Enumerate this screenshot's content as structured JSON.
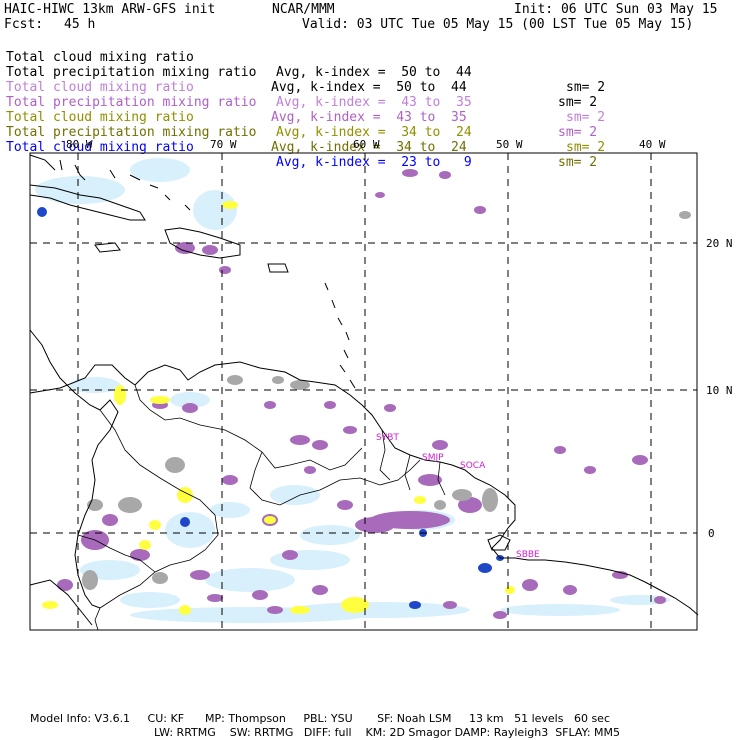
{
  "header": {
    "model_title": "HAIC-HIWC 13km ARW-GFS init",
    "org": "NCAR/MMM",
    "init": "Init: 06 UTC Sun 03 May 15",
    "fcst_label": "Fcst:",
    "fcst_value": "45 h",
    "valid": "Valid: 03 UTC Tue 05 May 15 (00 LST Tue 05 May 15)"
  },
  "legend": [
    {
      "name": "Total cloud mixing ratio",
      "kindex": "Avg, k-index =  50 to  44",
      "sm": "sm= 2",
      "color": "#000000"
    },
    {
      "name": "Total precipitation mixing ratio",
      "kindex": "Avg, k-index =  50 to  44",
      "sm": "sm= 2",
      "color": "#000000"
    },
    {
      "name": "Total cloud mixing ratio",
      "kindex": "Avg, k-index =  43 to  35",
      "sm": "sm= 2",
      "color": "#c080d8"
    },
    {
      "name": "Total precipitation mixing ratio",
      "kindex": "Avg, k-index =  43 to  35",
      "sm": "sm= 2",
      "color": "#b060c8"
    },
    {
      "name": "Total cloud mixing ratio",
      "kindex": "Avg, k-index =  34 to  24",
      "sm": "sm= 2",
      "color": "#909000"
    },
    {
      "name": "Total precipitation mixing ratio",
      "kindex": "Avg, k-index =  34 to  24",
      "sm": "sm= 2",
      "color": "#707000"
    },
    {
      "name": "Total cloud mixing ratio",
      "kindex": "Avg, k-index =  23 to   9",
      "sm": "sm= 2",
      "color": "#0000ff"
    }
  ],
  "map": {
    "lon_labels": [
      "80 W",
      "70 W",
      "60 W",
      "50 W",
      "40 W"
    ],
    "lat_labels": [
      "20 N",
      "10 N",
      "0"
    ],
    "stations": [
      "SYBT",
      "SMJP",
      "SOCA",
      "SBBE"
    ],
    "colors": {
      "coast": "#000000",
      "grid": "#000000",
      "purple": "#a86aba",
      "gray": "#a8a8a8",
      "yellow": "#ffff40",
      "lightblue": "#d8f0fc",
      "blue": "#1e48c8",
      "station": "#d020d0"
    }
  },
  "footer": {
    "line1": "Model Info: V3.6.1     CU: KF      MP: Thompson     PBL: YSU       SF: Noah LSM     13 km   51 levels   60 sec",
    "line2": "LW: RRTMG    SW: RRTMG   DIFF: full    KM: 2D Smagor DAMP: Rayleigh3  SFLAY: MM5"
  }
}
